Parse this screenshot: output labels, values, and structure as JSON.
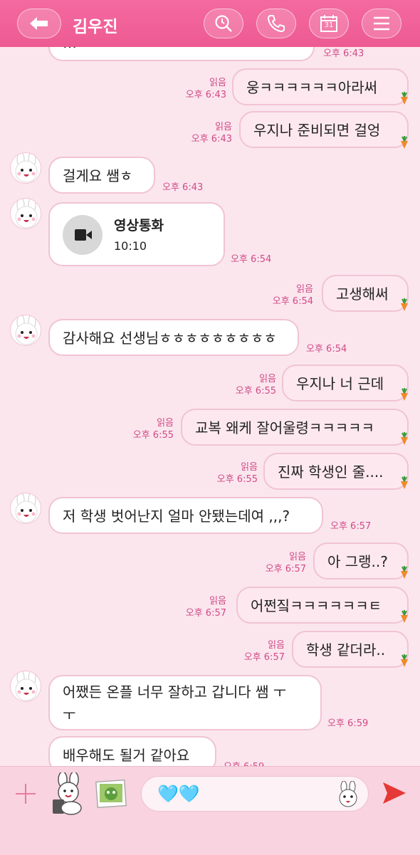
{
  "header": {
    "title": "김우진",
    "calendar_day": "31"
  },
  "messages": [
    {
      "from": "them",
      "text": "…",
      "time": "오후 6:43"
    },
    {
      "from": "me",
      "read": "읽음",
      "text": "웅ㅋㅋㅋㅋㅋㅋ아라써",
      "time": "오후 6:43"
    },
    {
      "from": "me",
      "read": "읽음",
      "text": "우지나 준비되면 걸엉",
      "time": "오후 6:43"
    },
    {
      "from": "them",
      "text": "걸게요 쌤ㅎ",
      "time": "오후 6:43"
    },
    {
      "from": "them",
      "type": "video-call",
      "title": "영상통화",
      "duration": "10:10",
      "time": "오후 6:54"
    },
    {
      "from": "me",
      "read": "읽음",
      "text": "고생해써",
      "time": "오후 6:54"
    },
    {
      "from": "them",
      "text": "감사해요 선생님ㅎㅎㅎㅎㅎㅎㅎㅎㅎ",
      "time": "오후 6:54"
    },
    {
      "from": "me",
      "read": "읽음",
      "text": "우지나 너 근데",
      "time": "오후 6:55"
    },
    {
      "from": "me",
      "read": "읽음",
      "text": "교복 왜케 잘어울령ㅋㅋㅋㅋㅋ",
      "time": "오후 6:55"
    },
    {
      "from": "me",
      "read": "읽음",
      "text": "진짜 학생인 줄....",
      "time": "오후 6:55"
    },
    {
      "from": "them",
      "text": "저 학생 벗어난지 얼마 안됐는데여 ,,,?",
      "time": "오후 6:57"
    },
    {
      "from": "me",
      "read": "읽음",
      "text": "아 그랭..?",
      "time": "오후 6:57"
    },
    {
      "from": "me",
      "read": "읽음",
      "text": "어쩐짘ㅋㅋㅋㅋㅋㅋㅌ",
      "time": "오후 6:57"
    },
    {
      "from": "me",
      "read": "읽음",
      "text": "학생 같더라..",
      "time": "오후 6:57"
    },
    {
      "from": "them",
      "text_line1": "어쨌든 온플 너무 잘하고 갑니다 쌤 ㅜ",
      "text_line2": "ㅜ",
      "time": "오후 6:59"
    },
    {
      "from": "them",
      "text": "배우해도 될거 같아요",
      "time": "오후 6:59"
    }
  ],
  "composer": {
    "emoji_text": "🩵🩵"
  },
  "colors": {
    "accent": "#ee5a93",
    "bubble_border": "#f1c3d4",
    "time_text": "#d24a86",
    "send": "#e53935"
  }
}
